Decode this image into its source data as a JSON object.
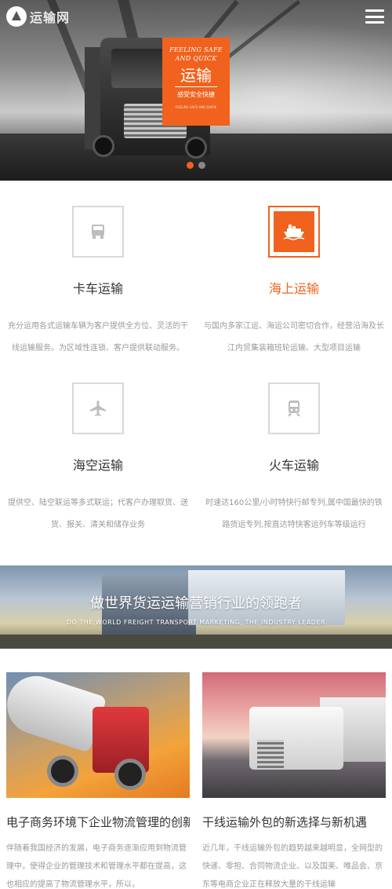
{
  "header": {
    "logo_text": "运输网",
    "menu_icon": "hamburger-menu-icon"
  },
  "hero": {
    "promo_en_line1": "FEELING SAFE",
    "promo_en_line2": "AND QUICK",
    "promo_title": "运输",
    "promo_sub": "感受安全快捷",
    "promo_tiny": "FEELING SAFE AND QUICK",
    "slides_total": 2,
    "slide_active": 1
  },
  "services": [
    {
      "title": "卡车运输",
      "icon": "truck-icon",
      "desc": "充分运用各式运输车辆为客户提供全方位、灵活的干线运输服务。为区域性连锁、客户提供联动服务。"
    },
    {
      "title": "海上运输",
      "icon": "ship-icon",
      "desc": "与国内多家江运、海运公司密切合作，经营沿海及长江内贸集装箱班轮运输、大型项目运输"
    },
    {
      "title": "海空运输",
      "icon": "airplane-icon",
      "desc": "提供空、陆空联运等多式联运；代客户办理取货、送货、报关、清关和储存业务"
    },
    {
      "title": "火车运输",
      "icon": "train-icon",
      "desc": "时速达160公里/小时特快行邮专列,属中国最快的铁路货运专列,按直达特快客运列车等级运行"
    }
  ],
  "banner": {
    "title": "做世界货运运输营销行业的领跑者",
    "subtitle": "DO THE WORLD FREIGHT TRANSPORT MARKETING, THE INDUSTRY LEADER"
  },
  "news": [
    {
      "title": "电子商务环境下企业物流管理的创新",
      "desc": "伴随着我国经济的发展，电子商务逐渐应用到物流管理中，使得企业的管理技术和管理水平都在提高，这也相应的提高了物流管理水平，所以，"
    },
    {
      "title": "干线运输外包的新选择与新机遇",
      "desc": "近几年，干线运输外包的趋势越来越明显，全网型的快递、零担、合同物流企业、以及国美、唯品会、京东等电商企业正在释放大量的干线运输"
    }
  ]
}
